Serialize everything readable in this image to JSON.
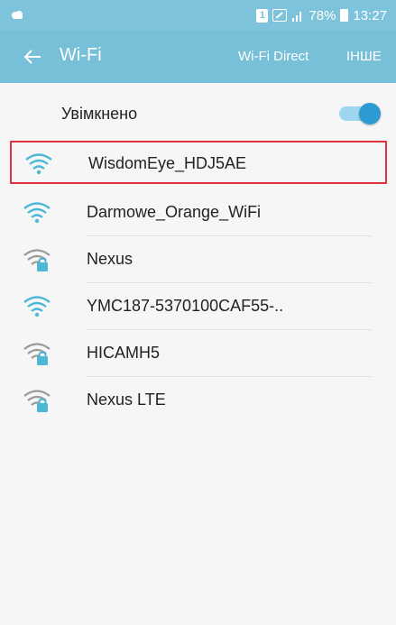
{
  "status_bar": {
    "sim_label": "1",
    "battery_text": "78%",
    "time": "13:27",
    "left_icon": "cloud-notification-icon"
  },
  "app_bar": {
    "title": "Wi-Fi",
    "wifi_direct_label": "Wi-Fi Direct",
    "more_label": "ІНШЕ"
  },
  "toggle": {
    "label": "Увімкнено",
    "state": "on"
  },
  "networks": [
    {
      "name": "WisdomEye_HDJ5AE",
      "secured": false
    },
    {
      "name": "Darmowe_Orange_WiFi",
      "secured": false
    },
    {
      "name": "Nexus",
      "secured": true
    },
    {
      "name": "YMC187-5370100CAF55-..",
      "secured": false
    },
    {
      "name": "HICAMH5",
      "secured": true
    },
    {
      "name": "Nexus LTE",
      "secured": true
    }
  ],
  "colors": {
    "status_bar": "#7ec3dc",
    "app_bar": "#78bfd8",
    "accent": "#2e9ad4",
    "wifi_open_icon": "#4cb8d6",
    "wifi_locked_icon": "#9a9a9a",
    "selection_border": "#e03340"
  }
}
